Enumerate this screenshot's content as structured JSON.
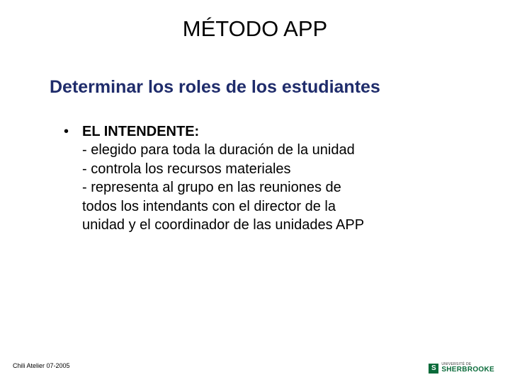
{
  "title": "MÉTODO APP",
  "subtitle": "Determinar los roles de los estudiantes",
  "bullet": {
    "mark": "•",
    "heading": "EL INTENDENTE:",
    "lines": [
      "- elegido para toda la duración de la unidad",
      "- controla los recursos materiales",
      "- representa al grupo en las reuniones de",
      " todos los intendants con el director de la",
      "unidad y el coordinador de las unidades APP"
    ]
  },
  "footer_left": "Chili Atelier 07-2005",
  "footer_logo": {
    "mark": "S",
    "small": "UNIVERSITÉ DE",
    "name": "SHERBROOKE"
  }
}
